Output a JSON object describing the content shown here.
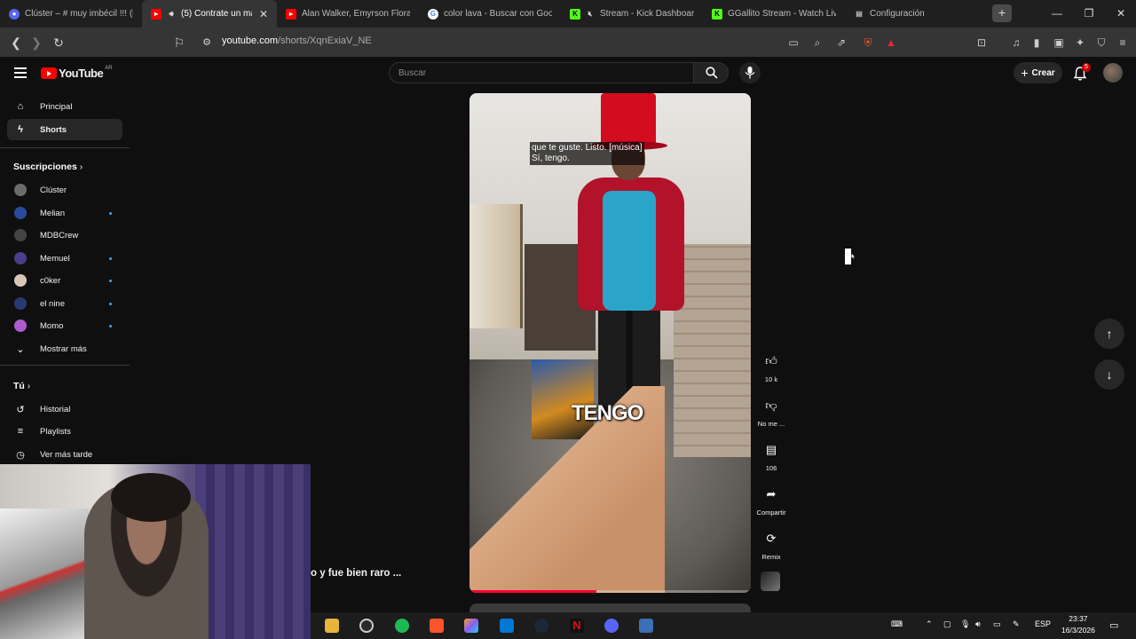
{
  "browser": {
    "tabs": [
      {
        "label": "Clúster – # muy imbécil !!! (l",
        "favicon": "discord"
      },
      {
        "label": "(5) Contrate un mag",
        "favicon": "youtube",
        "active": true
      },
      {
        "label": "Alan Walker, Emyrson Flora",
        "favicon": "youtube"
      },
      {
        "label": "color lava - Buscar con Goo",
        "favicon": "google"
      },
      {
        "label": "Stream - Kick Dashboar",
        "favicon": "kick"
      },
      {
        "label": "GGallito Stream - Watch Liv",
        "favicon": "kick"
      },
      {
        "label": "Configuración",
        "favicon": "settings"
      }
    ],
    "url_host": "youtube.com",
    "url_path": "/shorts/XqnExiaV_NE"
  },
  "youtube": {
    "logo_text": "YouTube",
    "country": "AR",
    "search_placeholder": "Buscar",
    "create_label": "Crear",
    "notification_count": "5"
  },
  "sidebar": {
    "items": [
      {
        "label": "Principal",
        "icon": "home-icon"
      },
      {
        "label": "Shorts",
        "icon": "shorts-icon"
      }
    ],
    "subscriptions_header": "Suscripciones",
    "subscriptions": [
      {
        "label": "Clúster",
        "color": "#6b6b6b",
        "dot": false
      },
      {
        "label": "Melian",
        "color": "#2b4a9c",
        "dot": true
      },
      {
        "label": "MDBCrew",
        "color": "#444",
        "dot": false
      },
      {
        "label": "Memuel",
        "color": "#4a3d8a",
        "dot": true
      },
      {
        "label": "c0ker",
        "color": "#d8c6b8",
        "dot": true
      },
      {
        "label": "el nine",
        "color": "#283a72",
        "dot": true
      },
      {
        "label": "Momo",
        "color": "#b05ad0",
        "dot": true
      }
    ],
    "show_more": "Mostrar más",
    "you_header": "Tú",
    "you_items": [
      {
        "label": "Historial",
        "icon": "history-icon"
      },
      {
        "label": "Playlists",
        "icon": "playlist-icon"
      },
      {
        "label": "Ver más tarde",
        "icon": "clock-icon"
      }
    ]
  },
  "video": {
    "caption_line1": "que te guste. Listo. [música]",
    "caption_line2": "Sí, tengo.",
    "overlay_text": "TENGO",
    "progress_fraction": 0.45
  },
  "actions": {
    "like_count": "10 k",
    "dislike_label": "No me ...",
    "comment_count": "106",
    "share_label": "Compartir",
    "remix_label": "Remix"
  },
  "below_text": "o y fue bien raro ...",
  "taskbar": {
    "language": "ESP",
    "time": "23:37",
    "date": "16/3/2026"
  }
}
